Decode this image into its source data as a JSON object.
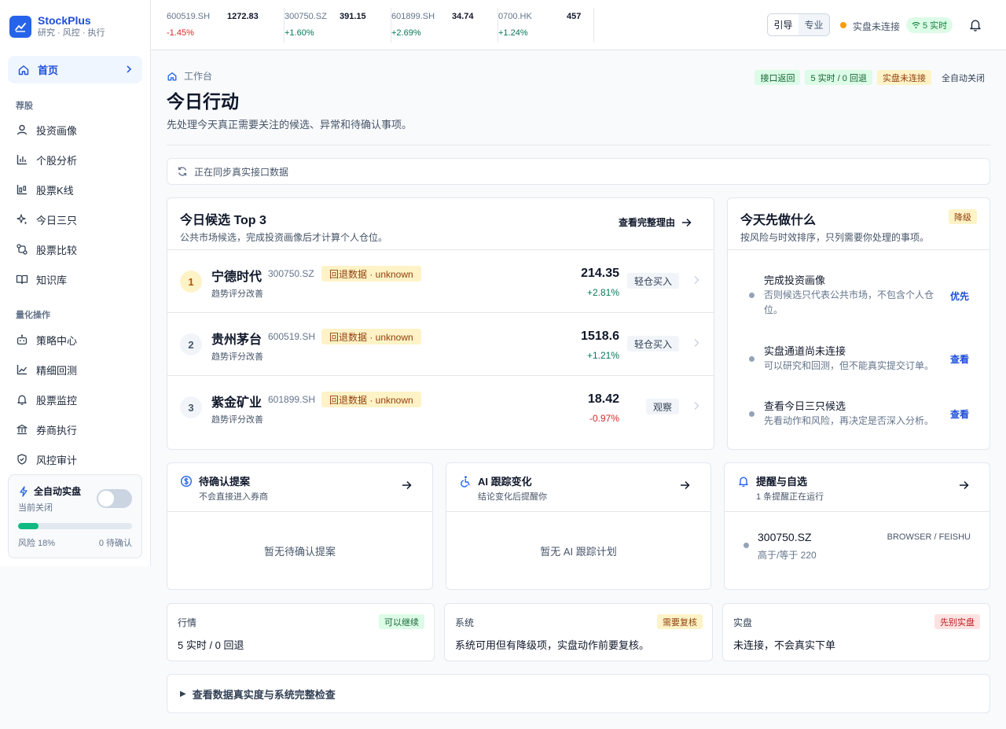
{
  "brand": {
    "name": "StockPlus",
    "tagline": "研究 · 风控 · 执行"
  },
  "sidebar": {
    "home": "首页",
    "section1": "荐股",
    "items1": [
      "投资画像",
      "个股分析",
      "股票K线",
      "今日三只",
      "股票比较",
      "知识库"
    ],
    "section2": "量化操作",
    "items2": [
      "策略中心",
      "精细回测",
      "股票监控",
      "券商执行",
      "风控审计"
    ],
    "auto": {
      "title": "全自动实盘",
      "status": "当前关闭",
      "risk": "风险 18%",
      "risk_fraction": 0.18,
      "pending": "0 待确认"
    }
  },
  "tickers": [
    {
      "code": "600519.SH",
      "price": "1272.83",
      "change": "-1.45%",
      "dir": "down"
    },
    {
      "code": "300750.SZ",
      "price": "391.15",
      "change": "+1.60%",
      "dir": "up"
    },
    {
      "code": "601899.SH",
      "price": "34.74",
      "change": "+2.69%",
      "dir": "up"
    },
    {
      "code": "0700.HK",
      "price": "457",
      "change": "+1.24%",
      "dir": "up"
    }
  ],
  "topbar": {
    "mode_guide": "引导",
    "mode_pro": "专业",
    "status": "实盘未连接",
    "live": "5 实时"
  },
  "header": {
    "breadcrumb": "工作台",
    "title": "今日行动",
    "subtitle": "先处理今天真正需要关注的候选、异常和待确认事项。",
    "badges": [
      "接口返回",
      "5 实时 / 0 回退",
      "实盘未连接",
      "全自动关闭"
    ]
  },
  "sync": "正在同步真实接口数据",
  "candidates": {
    "title": "今日候选 Top 3",
    "subtitle": "公共市场候选，完成投资画像后才计算个人仓位。",
    "link": "查看完整理由",
    "items": [
      {
        "rank": "1",
        "name": "宁德时代",
        "code": "300750.SZ",
        "tag": "回退数据 · unknown",
        "note": "趋势评分改善",
        "price": "214.35",
        "change": "+2.81%",
        "dir": "up",
        "action": "轻仓买入"
      },
      {
        "rank": "2",
        "name": "贵州茅台",
        "code": "600519.SH",
        "tag": "回退数据 · unknown",
        "note": "趋势评分改善",
        "price": "1518.6",
        "change": "+1.21%",
        "dir": "up",
        "action": "轻仓买入"
      },
      {
        "rank": "3",
        "name": "紫金矿业",
        "code": "601899.SH",
        "tag": "回退数据 · unknown",
        "note": "趋势评分改善",
        "price": "18.42",
        "change": "-0.97%",
        "dir": "down",
        "action": "观察"
      }
    ]
  },
  "todo": {
    "title": "今天先做什么",
    "subtitle": "按风险与时效排序，只列需要你处理的事项。",
    "badge": "降级",
    "items": [
      {
        "title": "完成投资画像",
        "desc": "否则候选只代表公共市场，不包含个人仓位。",
        "link": "优先"
      },
      {
        "title": "实盘通道尚未连接",
        "desc": "可以研究和回测，但不能真实提交订单。",
        "link": "查看"
      },
      {
        "title": "查看今日三只候选",
        "desc": "先看动作和风险，再决定是否深入分析。",
        "link": "查看"
      }
    ]
  },
  "panels": {
    "proposals": {
      "title": "待确认提案",
      "subtitle": "不会直接进入券商",
      "empty": "暂无待确认提案"
    },
    "ai": {
      "title": "AI 跟踪变化",
      "subtitle": "结论变化后提醒你",
      "empty": "暂无 AI 跟踪计划"
    },
    "alerts": {
      "title": "提醒与自选",
      "subtitle": "1 条提醒正在运行",
      "item_code": "300750.SZ",
      "item_cond": "高于/等于 220",
      "item_channel": "BROWSER / FEISHU"
    }
  },
  "stats": [
    {
      "label": "行情",
      "badge": "可以继续",
      "value": "5 实时 / 0 回退"
    },
    {
      "label": "系统",
      "badge": "需要复核",
      "value": "系统可用但有降级项，实盘动作前要复核。"
    },
    {
      "label": "实盘",
      "badge": "先别实盘",
      "value": "未连接，不会真实下单"
    }
  ],
  "details": "查看数据真实度与系统完整检查",
  "colors": {
    "accent": "#2563eb",
    "up": "#047857",
    "down": "#dc2626",
    "warn": "#f59e0b"
  }
}
